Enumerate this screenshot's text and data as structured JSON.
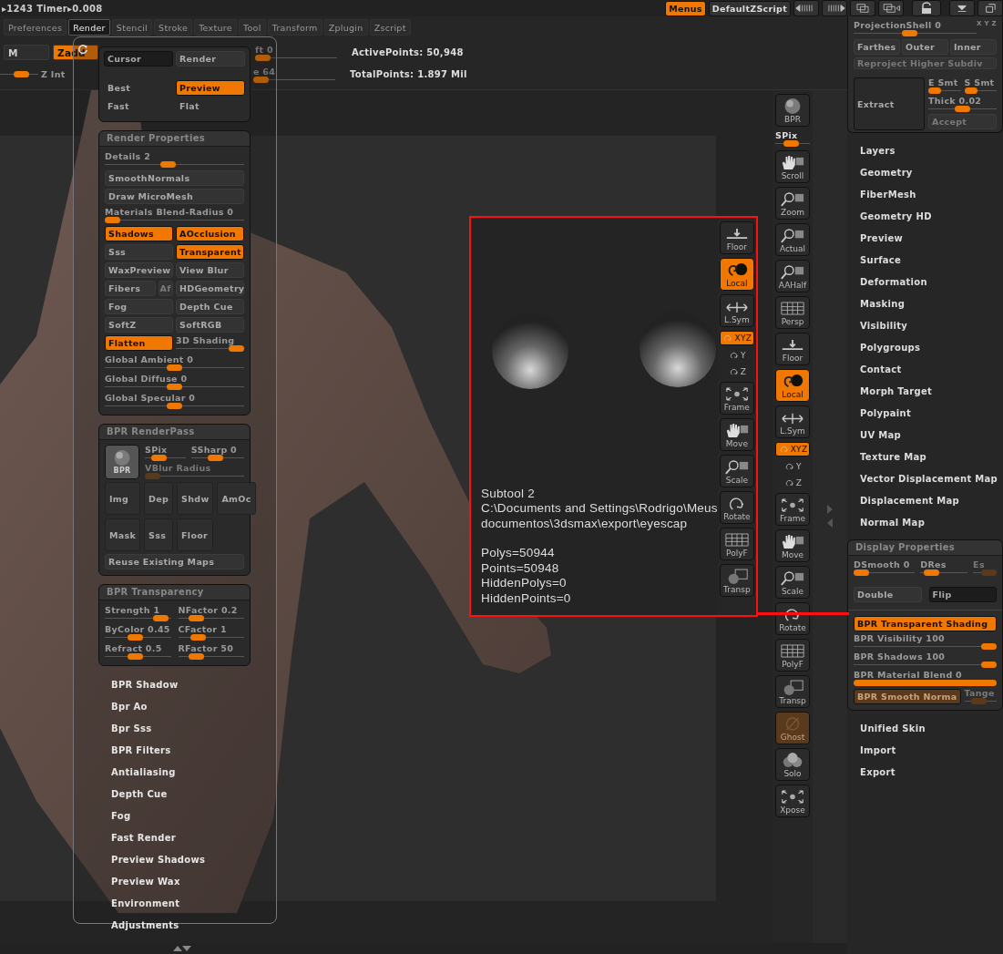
{
  "top_bar": {
    "status": "▸1243 Timer▸0.008",
    "buttons": [
      {
        "label": "Menus",
        "selected": true
      },
      {
        "label": "DefaultZScript",
        "selected": false
      }
    ]
  },
  "menu_tabs": [
    {
      "label": "Preferences",
      "selected": false
    },
    {
      "label": "Render",
      "selected": true
    },
    {
      "label": "Stencil",
      "selected": false
    },
    {
      "label": "Stroke",
      "selected": false
    },
    {
      "label": "Texture",
      "selected": false
    },
    {
      "label": "Tool",
      "selected": false
    },
    {
      "label": "Transform",
      "selected": false
    },
    {
      "label": "Zplugin",
      "selected": false
    },
    {
      "label": "Zscript",
      "selected": false
    }
  ],
  "toolbar": {
    "buttons": [
      {
        "label": "M",
        "selected": false
      },
      {
        "label": "Zadd",
        "selected": true
      }
    ],
    "z_intensity": {
      "label": "Z Int",
      "level": 0.6
    },
    "slider_1": {
      "label": "ft 0",
      "level": 0
    },
    "slider_2": {
      "label": "e 64",
      "level": 0
    },
    "stats": [
      "ActivePoints: 50,948",
      "TotalPoints: 1.897 Mil"
    ]
  },
  "render_panel": {
    "modes": [
      {
        "kind": "dark-button",
        "label": "Cursor",
        "selected": false
      },
      {
        "kind": "button",
        "label": "Render",
        "selected": false
      },
      {
        "kind": "option",
        "label": "Best",
        "selected": false
      },
      {
        "kind": "option",
        "label": "Preview",
        "selected": true
      },
      {
        "kind": "option",
        "label": "Fast",
        "selected": false
      },
      {
        "kind": "option",
        "label": "Flat",
        "selected": false
      }
    ],
    "properties": {
      "title": "Render Properties",
      "items": [
        {
          "kind": "slider",
          "label": "Details 2",
          "level": 0.45
        },
        {
          "kind": "button",
          "label": "SmoothNormals",
          "selected": false
        },
        {
          "kind": "button",
          "label": "Draw MicroMesh",
          "selected": false
        },
        {
          "kind": "slider",
          "label": "Materials Blend-Radius 0",
          "level": 0
        },
        {
          "kind": "toggle",
          "label": "Shadows",
          "selected": true
        },
        {
          "kind": "toggle",
          "label": "AOcclusion",
          "selected": true
        },
        {
          "kind": "toggle",
          "label": "Sss",
          "selected": false
        },
        {
          "kind": "toggle",
          "label": "Transparent",
          "selected": true
        },
        {
          "kind": "toggle",
          "label": "WaxPreview",
          "selected": false
        },
        {
          "kind": "toggle",
          "label": "View Blur",
          "selected": false
        },
        {
          "kind": "narrow",
          "label": "Fibers",
          "selected": false
        },
        {
          "kind": "mini",
          "label": "Af",
          "selected": false
        },
        {
          "kind": "toggle",
          "label": "HDGeometry",
          "selected": false
        },
        {
          "kind": "toggle",
          "label": "Fog",
          "selected": false
        },
        {
          "kind": "toggle",
          "label": "Depth Cue",
          "selected": false
        },
        {
          "kind": "toggle",
          "label": "SoftZ",
          "selected": false
        },
        {
          "kind": "toggle",
          "label": "SoftRGB",
          "selected": false
        },
        {
          "kind": "toggle",
          "label": "Flatten",
          "selected": true
        },
        {
          "kind": "half-slider",
          "label": "3D Shading",
          "level": 1
        },
        {
          "kind": "slider",
          "label": "Global Ambient 0",
          "level": 0.5
        },
        {
          "kind": "slider",
          "label": "Global Diffuse 0",
          "level": 0.5
        },
        {
          "kind": "slider",
          "label": "Global Specular 0",
          "level": 0.5
        }
      ]
    },
    "renderpass": {
      "title": "BPR RenderPass",
      "bpr_button": "BPR",
      "sliders": [
        {
          "label": "SPix",
          "level": 0.25,
          "disabled": false
        },
        {
          "label": "SSharp 0",
          "level": 0.45,
          "disabled": false
        },
        {
          "label": "VBlur Radius",
          "level": 0,
          "disabled": true
        }
      ],
      "passes": [
        "Img",
        "Dep",
        "Shdw",
        "AmOc",
        "Mask",
        "Sss",
        "Floor"
      ],
      "reuse": "Reuse Existing Maps"
    },
    "transparency": {
      "title": "BPR Transparency",
      "sliders": [
        {
          "label": "Strength 1",
          "level": 0.95
        },
        {
          "label": "NFactor 0.2",
          "level": 0.2
        },
        {
          "label": "ByColor 0.45",
          "level": 0.45
        },
        {
          "label": "CFactor 1",
          "level": 0.25
        },
        {
          "label": "Refract 0.5",
          "level": 0.45
        },
        {
          "label": "RFactor 50",
          "level": 0.2
        }
      ]
    },
    "sections": [
      "BPR Shadow",
      "Bpr Ao",
      "Bpr Sss",
      "BPR Filters",
      "Antialiasing",
      "Depth Cue",
      "Fog",
      "Fast Render",
      "Preview Shadows",
      "Preview Wax",
      "Environment",
      "Adjustments"
    ]
  },
  "callout": {
    "title": "Subtool 2",
    "path": [
      "C:\\Documents and Settings\\Rodrigo\\Meus",
      "documentos\\3dsmax\\export\\eyescap"
    ],
    "stats": [
      "Polys=50944",
      "Points=50948",
      "HiddenPolys=0",
      "HiddenPoints=0"
    ],
    "shelf": [
      {
        "kind": "button",
        "label": "Floor",
        "selected": false,
        "disabled": false
      },
      {
        "kind": "button",
        "label": "Local",
        "selected": true,
        "disabled": false
      },
      {
        "kind": "button",
        "label": "L.Sym",
        "selected": false,
        "disabled": false
      },
      {
        "kind": "toggle-small",
        "label": "XYZ",
        "selected": true,
        "disabled": false
      },
      {
        "kind": "axis",
        "label": "Y",
        "selected": false,
        "disabled": false
      },
      {
        "kind": "axis",
        "label": "Z",
        "selected": false,
        "disabled": false
      },
      {
        "kind": "button",
        "label": "Frame",
        "selected": false,
        "disabled": false
      },
      {
        "kind": "button",
        "label": "Move",
        "selected": false,
        "disabled": false
      },
      {
        "kind": "button",
        "label": "Scale",
        "selected": false,
        "disabled": false
      },
      {
        "kind": "button",
        "label": "Rotate",
        "selected": false,
        "disabled": false
      },
      {
        "kind": "button",
        "label": "PolyF",
        "selected": false,
        "disabled": false
      },
      {
        "kind": "button",
        "label": "Transp",
        "selected": false,
        "disabled": false
      }
    ]
  },
  "shelf": [
    {
      "kind": "button",
      "label": "BPR",
      "selected": false,
      "disabled": false
    },
    {
      "kind": "slider",
      "label": "SPix",
      "level": 0.45
    },
    {
      "kind": "button",
      "label": "Scroll",
      "selected": false,
      "disabled": false
    },
    {
      "kind": "button",
      "label": "Zoom",
      "selected": false,
      "disabled": false
    },
    {
      "kind": "button",
      "label": "Actual",
      "selected": false,
      "disabled": false
    },
    {
      "kind": "button",
      "label": "AAHalf",
      "selected": false,
      "disabled": false
    },
    {
      "kind": "button",
      "label": "Persp",
      "selected": false,
      "disabled": false
    },
    {
      "kind": "button",
      "label": "Floor",
      "selected": false,
      "disabled": false
    },
    {
      "kind": "button",
      "label": "Local",
      "selected": true,
      "disabled": false
    },
    {
      "kind": "button",
      "label": "L.Sym",
      "selected": false,
      "disabled": false
    },
    {
      "kind": "toggle-small",
      "label": "XYZ",
      "selected": true,
      "disabled": false
    },
    {
      "kind": "axis",
      "label": "Y",
      "selected": false,
      "disabled": false
    },
    {
      "kind": "axis",
      "label": "Z",
      "selected": false,
      "disabled": false
    },
    {
      "kind": "button",
      "label": "Frame",
      "selected": false,
      "disabled": false
    },
    {
      "kind": "button",
      "label": "Move",
      "selected": false,
      "disabled": false
    },
    {
      "kind": "button",
      "label": "Scale",
      "selected": false,
      "disabled": false
    },
    {
      "kind": "button",
      "label": "Rotate",
      "selected": false,
      "disabled": false
    },
    {
      "kind": "button",
      "label": "PolyF",
      "selected": false,
      "disabled": false
    },
    {
      "kind": "button",
      "label": "Transp",
      "selected": false,
      "disabled": false
    },
    {
      "kind": "button",
      "label": "Ghost",
      "selected": true,
      "disabled": true
    },
    {
      "kind": "button",
      "label": "Solo",
      "selected": false,
      "disabled": false
    },
    {
      "kind": "button",
      "label": "Xpose",
      "selected": false,
      "disabled": false
    }
  ],
  "tool_palette": {
    "projection": {
      "slider": {
        "label": "ProjectionShell 0",
        "level": 0.45
      },
      "axes": "X Y Z",
      "buttons": [
        "Farthes",
        "Outer",
        "Inner"
      ],
      "reproject": "Reproject Higher Subdiv",
      "extract": "Extract",
      "smooth": [
        {
          "label": "E Smt",
          "level": 0
        },
        {
          "label": "S Smt",
          "level": 0
        }
      ],
      "thick": {
        "label": "Thick 0.02",
        "level": 0.5
      },
      "accept": "Accept"
    },
    "subpalettes": [
      "Layers",
      "Geometry",
      "FiberMesh",
      "Geometry HD",
      "Preview",
      "Surface",
      "Deformation",
      "Masking",
      "Visibility",
      "Polygroups",
      "Contact",
      "Morph Target",
      "Polypaint",
      "UV Map",
      "Texture Map",
      "Vector Displacement Map",
      "Displacement Map",
      "Normal Map"
    ],
    "display_properties": {
      "title": "Display Properties",
      "sliders": [
        {
          "label": "DSmooth 0",
          "level": 0,
          "disabled": false
        },
        {
          "label": "DRes",
          "level": 0.1,
          "disabled": false
        },
        {
          "label": "Es",
          "level": 1,
          "disabled": true
        }
      ],
      "buttons": [
        {
          "label": "Double",
          "selected": false
        },
        {
          "label": "Flip",
          "selected": true
        }
      ],
      "bpr_shading": {
        "label": "BPR Transparent Shading",
        "selected": true
      },
      "bpr_sliders": [
        {
          "kind": "slider",
          "label": "BPR Visibility 100",
          "level": 1
        },
        {
          "kind": "slider",
          "label": "BPR Shadows 100",
          "level": 1
        },
        {
          "kind": "fill",
          "label": "BPR Material Blend 0",
          "level": 1
        }
      ],
      "smooth_normals": {
        "label": "BPR Smooth Norma",
        "selected": true,
        "disabled": true
      },
      "tangent": {
        "label": "Tange",
        "level": 0.4,
        "disabled": true
      }
    },
    "subpalettes_after": [
      "Unified Skin",
      "Import",
      "Export"
    ]
  }
}
